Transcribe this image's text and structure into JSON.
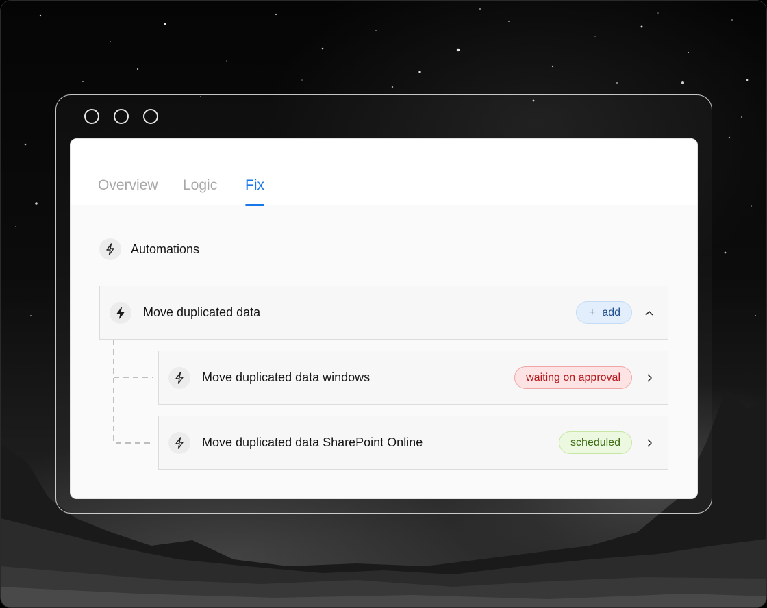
{
  "tabs": [
    {
      "label": "Overview",
      "active": false
    },
    {
      "label": "Logic",
      "active": false
    },
    {
      "label": "Fix",
      "active": true
    }
  ],
  "section": {
    "title": "Automations",
    "icon": "bolt-icon"
  },
  "parent": {
    "title": "Move duplicated data",
    "action_icon": "plus",
    "action_label": "add",
    "chevron": "chevron-up-icon"
  },
  "children": [
    {
      "title": "Move duplicated data windows",
      "status": "waiting on approval",
      "status_color": "#b4161b"
    },
    {
      "title": "Move duplicated data SharePoint Online",
      "status": "scheduled",
      "status_color": "#3b6d12"
    }
  ],
  "colors": {
    "accent": "#1877e8",
    "add_bg": "#e2eefb",
    "waiting_bg": "#fde3e3",
    "scheduled_bg": "#ecf8df"
  }
}
